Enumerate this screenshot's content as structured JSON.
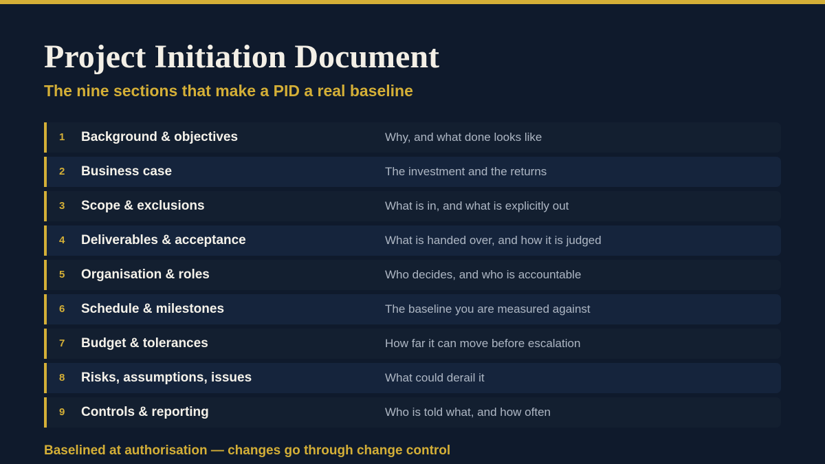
{
  "title": "Project Initiation Document",
  "subtitle": "The nine sections that make a PID a real baseline",
  "sections": [
    {
      "number": "1",
      "name": "Background & objectives",
      "description": "Why, and what done looks like"
    },
    {
      "number": "2",
      "name": "Business case",
      "description": "The investment and the returns"
    },
    {
      "number": "3",
      "name": "Scope & exclusions",
      "description": "What is in, and what is explicitly out"
    },
    {
      "number": "4",
      "name": "Deliverables & acceptance",
      "description": "What is handed over, and how it is judged"
    },
    {
      "number": "5",
      "name": "Organisation & roles",
      "description": "Who decides, and who is accountable"
    },
    {
      "number": "6",
      "name": "Schedule & milestones",
      "description": "The baseline you are measured against"
    },
    {
      "number": "7",
      "name": "Budget & tolerances",
      "description": "How far it can move before escalation"
    },
    {
      "number": "8",
      "name": "Risks, assumptions, issues",
      "description": "What could derail it"
    },
    {
      "number": "9",
      "name": "Controls & reporting",
      "description": "Who is told what, and how often"
    }
  ],
  "footer": "Baselined at authorisation — changes go through change control",
  "colors": {
    "background": "#0f1a2c",
    "accent": "#d4af37",
    "row_odd": "#131f30",
    "row_even": "#15243c"
  }
}
